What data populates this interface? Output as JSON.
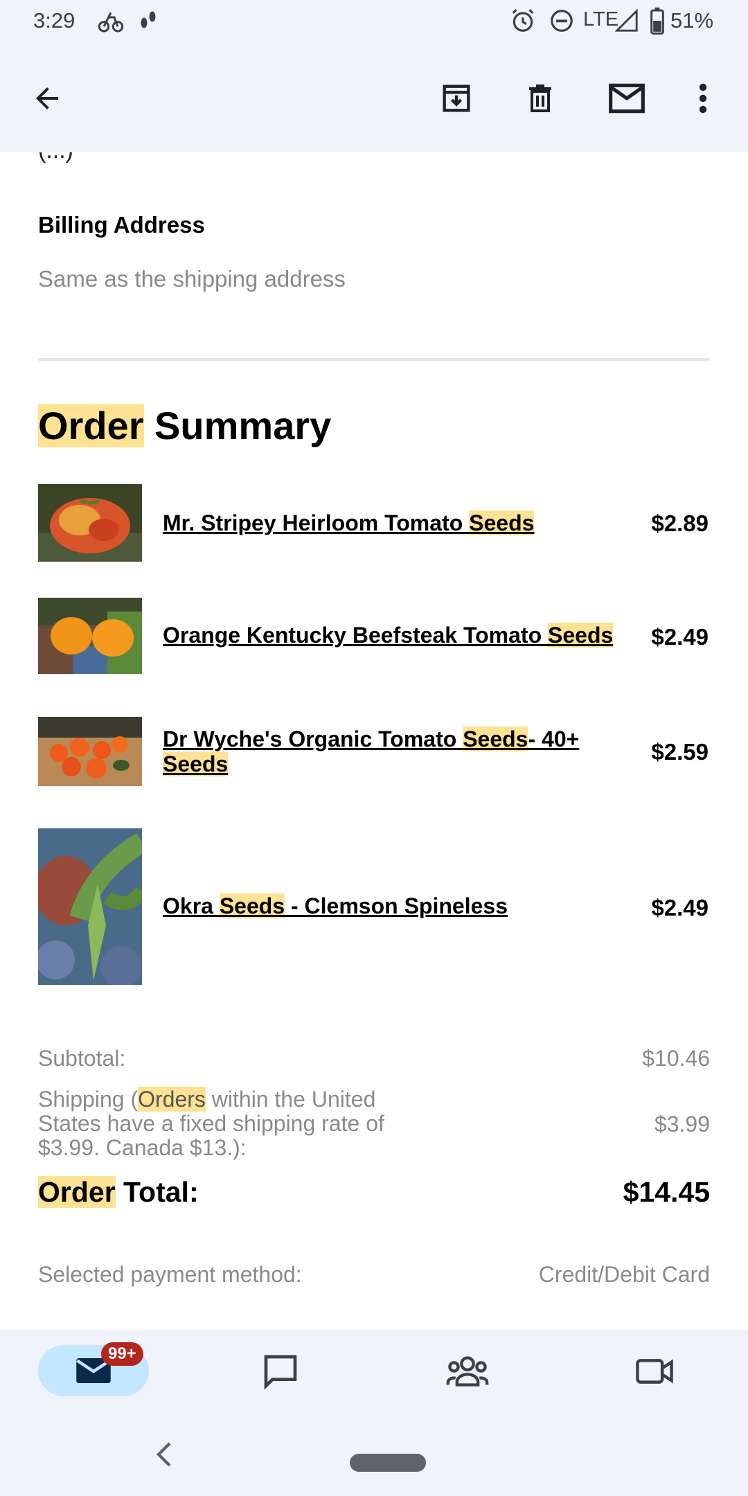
{
  "status_bar": {
    "time": "3:29",
    "network": "LTE",
    "battery": "51%"
  },
  "app_bar": {
    "back_icon": "arrow-back-icon",
    "archive_icon": "archive-icon",
    "delete_icon": "trash-icon",
    "mark_unread_icon": "mail-icon",
    "more_icon": "more-vertical-icon"
  },
  "email": {
    "cutoff_text": "(...)",
    "billing": {
      "title": "Billing Address",
      "value": "Same as the shipping address"
    },
    "order_summary": {
      "title_highlight": "Order",
      "title_rest": " Summary"
    },
    "items": [
      {
        "name_before": "Mr. Stripey Heirloom Tomato ",
        "name_highlight": "Seeds",
        "name_after": "",
        "price": "$2.89"
      },
      {
        "name_before": "Orange Kentucky Beefsteak Tomato ",
        "name_highlight": "Seeds",
        "name_after": "",
        "price": "$2.49"
      },
      {
        "name_before": "Dr Wyche's Organic Tomato ",
        "name_highlight": "Seeds",
        "name_after": "- 40+",
        "name_line2_highlight": "Seeds",
        "price": "$2.59"
      },
      {
        "name_before": "Okra ",
        "name_highlight": "Seeds",
        "name_after": " - Clemson Spineless",
        "price": "$2.49"
      }
    ],
    "totals": {
      "subtotal_label": "Subtotal:",
      "subtotal_value": "$10.46",
      "shipping_label_before": "Shipping (",
      "shipping_label_highlight": "Orders",
      "shipping_label_after": " within the United States have a fixed shipping rate of $3.99. Canada $13.):",
      "shipping_value": "$3.99",
      "order_total_highlight": "Order",
      "order_total_rest": " Total:",
      "order_total_value": "$14.45",
      "payment_label": "Selected payment method:",
      "payment_value": "Credit/Debit Card"
    }
  },
  "bottom_nav": {
    "mail_badge": "99+",
    "items": [
      "mail-icon",
      "chat-icon",
      "spaces-icon",
      "meet-icon"
    ]
  },
  "colors": {
    "highlight": "#fde293",
    "bar_bg": "#f0f3fa",
    "pill": "#c2e7ff",
    "badge": "#b3261e"
  }
}
